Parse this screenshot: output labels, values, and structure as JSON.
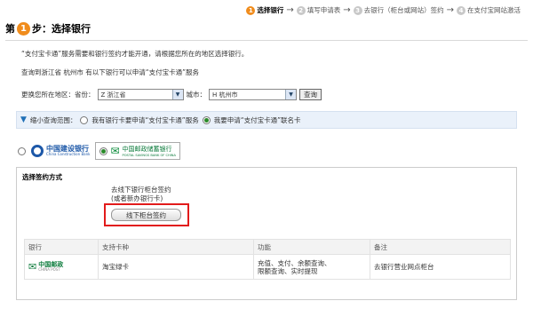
{
  "steps": [
    {
      "num": "1",
      "label": "选择银行",
      "active": true
    },
    {
      "num": "2",
      "label": "填写申请表"
    },
    {
      "num": "3",
      "label": "去银行（柜台或网站）签约"
    },
    {
      "num": "4",
      "label": "在支付宝网站激活"
    }
  ],
  "title": {
    "prefix": "第",
    "num": "1",
    "suffix": "步：选择银行"
  },
  "notes": {
    "service_notice": "“支付宝卡通”服务需要和银行签约才能开通，请根据您所在的地区选择银行。",
    "region_result": "查询到浙江省 杭州市 有以下银行可以申请“支付宝卡通”服务"
  },
  "region": {
    "label": "更换您所在地区：省份：",
    "province": "Z 浙江省",
    "city_label": "城市：",
    "city": "H 杭州市",
    "query_button": "查询"
  },
  "filter": {
    "label": "缩小查询范围：",
    "option1": "我有银行卡要申请“支付宝卡通”服务",
    "option2": "我要申请“支付宝卡通”联名卡",
    "selected": "option2"
  },
  "banks": [
    {
      "cn": "中国建设银行",
      "en": "China Construction Bank"
    },
    {
      "cn": "中国邮政储蓄银行",
      "en": "POSTAL SAVINGS BANK OF CHINA",
      "selected": true
    }
  ],
  "sign_method": {
    "title": "选择签约方式",
    "desc_line1": "去线下银行柜台签约",
    "desc_line2": "(或者新办银行卡)",
    "button": "线下柜台签约"
  },
  "table": {
    "headers": [
      "银行",
      "支持卡种",
      "功能",
      "备注"
    ],
    "rows": [
      {
        "bank_cn": "中国邮政",
        "bank_en": "CHINA POST",
        "card": "淘宝绿卡",
        "func_line1": "充值、支付、余额查询、",
        "func_line2": "限额查询、实时提现",
        "remark": "去银行营业网点柜台"
      }
    ]
  },
  "colors": {
    "accent_orange": "#f08c1c",
    "highlight_red": "#e21b1b",
    "psbc_green": "#0a7a3a"
  }
}
